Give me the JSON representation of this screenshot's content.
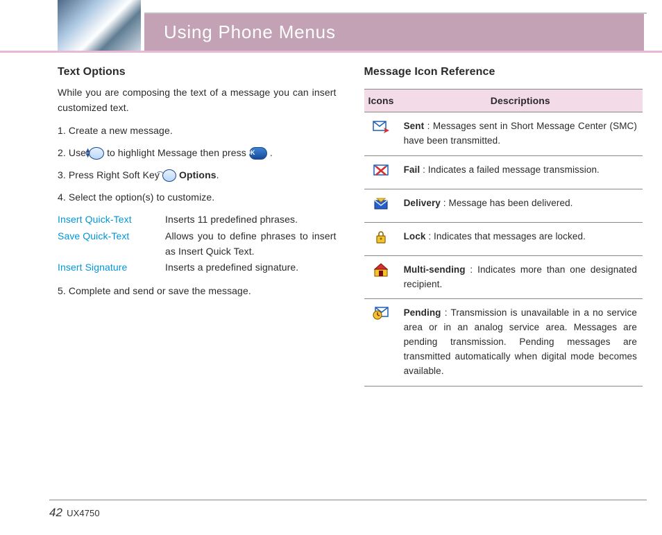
{
  "header": {
    "title": "Using Phone Menus"
  },
  "left": {
    "h": "Text Options",
    "intro": "While you are composing the text of a message you can insert customized text.",
    "steps": {
      "s1": "1.  Create a new message.",
      "s2a": "2.  Use ",
      "s2b": " to highlight Message then press ",
      "s2c": " .",
      "s3a": "3.  Press Right Soft Key ",
      "s3opt": "Options",
      "s3b": ".",
      "s4": "4.  Select the option(s) to customize."
    },
    "defs": [
      {
        "term": "Insert Quick-Text",
        "desc": "Inserts 11 predefined phrases."
      },
      {
        "term": "Save Quick-Text",
        "desc": "Allows you to define phrases to insert as Insert Quick Text."
      },
      {
        "term": "Insert Signature",
        "desc": "Inserts a predefined signature."
      }
    ],
    "step5": "5.  Complete and send or save the message."
  },
  "right": {
    "h": "Message Icon Reference",
    "th_icons": "Icons",
    "th_desc": "Descriptions",
    "rows": [
      {
        "icon": "sent",
        "label": "Sent",
        "desc": " : Messages sent in Short Message Center (SMC) have been transmitted."
      },
      {
        "icon": "fail",
        "label": "Fail",
        "desc": " : Indicates a failed message transmission."
      },
      {
        "icon": "delivery",
        "label": "Delivery",
        "desc": " : Message has been delivered."
      },
      {
        "icon": "lock",
        "label": "Lock",
        "desc": " : Indicates that messages are locked."
      },
      {
        "icon": "multi",
        "label": "Multi-sending",
        "desc": " : Indicates more than one designated recipient."
      },
      {
        "icon": "pending",
        "label": "Pending",
        "desc": " : Transmission is unavailable in a no service area or in an analog service area. Messages are pending transmission. Pending messages are transmitted automatically when digital mode becomes available."
      }
    ]
  },
  "footer": {
    "page": "42",
    "model": "UX4750"
  },
  "icons": {
    "ok_label": "OK"
  }
}
